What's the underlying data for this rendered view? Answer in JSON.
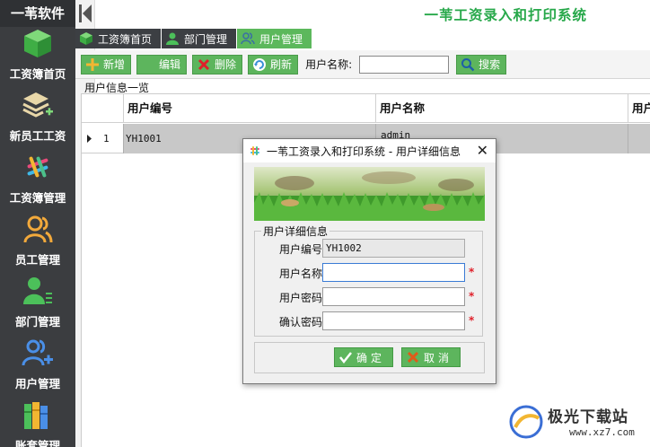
{
  "app": {
    "brand": "一苇软件",
    "title": "一苇工资录入和打印系统"
  },
  "sidebar": {
    "items": [
      {
        "label": "工资簿首页",
        "icon": "cube-icon"
      },
      {
        "label": "新员工工资",
        "icon": "layers-add-icon"
      },
      {
        "label": "工资簿管理",
        "icon": "slack-icon"
      },
      {
        "label": "员工管理",
        "icon": "users-icon"
      },
      {
        "label": "部门管理",
        "icon": "user-list-icon"
      },
      {
        "label": "用户管理",
        "icon": "user-add-icon"
      },
      {
        "label": "账套管理",
        "icon": "books-icon"
      }
    ]
  },
  "tabs": [
    {
      "label": "工资簿首页",
      "icon": "cube-icon"
    },
    {
      "label": "部门管理",
      "icon": "user-icon"
    },
    {
      "label": "用户管理",
      "icon": "users-icon"
    }
  ],
  "toolbar": {
    "add_label": "新增",
    "edit_label": "编辑",
    "delete_label": "删除",
    "refresh_label": "刷新",
    "username_label": "用户名称:",
    "username_value": "",
    "search_label": "搜索"
  },
  "panel": {
    "title": "用户信息一览"
  },
  "grid": {
    "columns": [
      "用户编号",
      "用户名称",
      "用户"
    ],
    "rows": [
      {
        "index": "1",
        "code": "YH1001",
        "name": "admin"
      }
    ]
  },
  "dialog": {
    "title": "一苇工资录入和打印系统 - 用户详细信息",
    "group_label": "用户详细信息",
    "fields": {
      "code": {
        "label": "用户编号:",
        "value": "YH1002"
      },
      "name": {
        "label": "用户名称:",
        "value": ""
      },
      "password": {
        "label": "用户密码:",
        "value": ""
      },
      "confirm": {
        "label": "确认密码:",
        "value": ""
      }
    },
    "required_mark": "*",
    "ok_label": "确定",
    "cancel_label": "取消"
  },
  "watermark": {
    "text": "极光下载站",
    "url": "www.xz7.com"
  },
  "colors": {
    "accent": "#5cb85c",
    "sidebar": "#3b3d40",
    "title_green": "#27a84a",
    "required": "#e0202a"
  }
}
